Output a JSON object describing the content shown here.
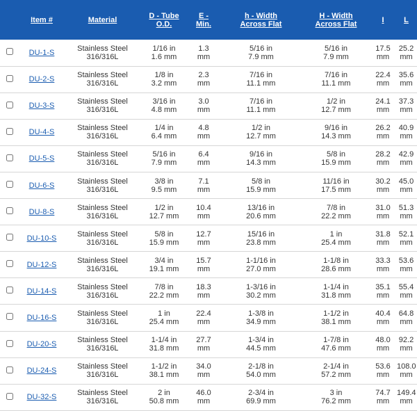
{
  "header": {
    "item": "Item #",
    "material": "Material",
    "d_tube_1": "D - Tube",
    "d_tube_2": "O.D.",
    "e_min_1": "E -",
    "e_min_2": "Min.",
    "h_small_1": "h - Width",
    "h_small_2": "Across Flat",
    "h_big_1": "H - Width",
    "h_big_2": "Across Flat",
    "i": "I",
    "l": "L"
  },
  "rows": [
    {
      "item": "DU-1-S",
      "mat1": "Stainless Steel",
      "mat2": "316/316L",
      "d1": "1/16 in",
      "d2": "1.6 mm",
      "e1": "1.3",
      "e2": "mm",
      "hs1": "5/16 in",
      "hs2": "7.9 mm",
      "hb1": "5/16 in",
      "hb2": "7.9 mm",
      "i1": "17.5",
      "i2": "mm",
      "l1": "25.2",
      "l2": "mm"
    },
    {
      "item": "DU-2-S",
      "mat1": "Stainless Steel",
      "mat2": "316/316L",
      "d1": "1/8 in",
      "d2": "3.2 mm",
      "e1": "2.3",
      "e2": "mm",
      "hs1": "7/16 in",
      "hs2": "11.1 mm",
      "hb1": "7/16 in",
      "hb2": "11.1 mm",
      "i1": "22.4",
      "i2": "mm",
      "l1": "35.6",
      "l2": "mm"
    },
    {
      "item": "DU-3-S",
      "mat1": "Stainless Steel",
      "mat2": "316/316L",
      "d1": "3/16 in",
      "d2": "4.8 mm",
      "e1": "3.0",
      "e2": "mm",
      "hs1": "7/16 in",
      "hs2": "11.1 mm",
      "hb1": "1/2 in",
      "hb2": "12.7 mm",
      "i1": "24.1",
      "i2": "mm",
      "l1": "37.3",
      "l2": "mm"
    },
    {
      "item": "DU-4-S",
      "mat1": "Stainless Steel",
      "mat2": "316/316L",
      "d1": "1/4 in",
      "d2": "6.4 mm",
      "e1": "4.8",
      "e2": "mm",
      "hs1": "1/2 in",
      "hs2": "12.7 mm",
      "hb1": "9/16 in",
      "hb2": "14.3 mm",
      "i1": "26.2",
      "i2": "mm",
      "l1": "40.9",
      "l2": "mm"
    },
    {
      "item": "DU-5-S",
      "mat1": "Stainless Steel",
      "mat2": "316/316L",
      "d1": "5/16 in",
      "d2": "7.9 mm",
      "e1": "6.4",
      "e2": "mm",
      "hs1": "9/16 in",
      "hs2": "14.3 mm",
      "hb1": "5/8 in",
      "hb2": "15.9 mm",
      "i1": "28.2",
      "i2": "mm",
      "l1": "42.9",
      "l2": "mm"
    },
    {
      "item": "DU-6-S",
      "mat1": "Stainless Steel",
      "mat2": "316/316L",
      "d1": "3/8 in",
      "d2": "9.5 mm",
      "e1": "7.1",
      "e2": "mm",
      "hs1": "5/8 in",
      "hs2": "15.9 mm",
      "hb1": "11/16 in",
      "hb2": "17.5 mm",
      "i1": "30.2",
      "i2": "mm",
      "l1": "45.0",
      "l2": "mm"
    },
    {
      "item": "DU-8-S",
      "mat1": "Stainless Steel",
      "mat2": "316/316L",
      "d1": "1/2 in",
      "d2": "12.7 mm",
      "e1": "10.4",
      "e2": "mm",
      "hs1": "13/16 in",
      "hs2": "20.6 mm",
      "hb1": "7/8 in",
      "hb2": "22.2 mm",
      "i1": "31.0",
      "i2": "mm",
      "l1": "51.3",
      "l2": "mm"
    },
    {
      "item": "DU-10-S",
      "mat1": "Stainless Steel",
      "mat2": "316/316L",
      "d1": "5/8 in",
      "d2": "15.9 mm",
      "e1": "12.7",
      "e2": "mm",
      "hs1": "15/16 in",
      "hs2": "23.8 mm",
      "hb1": "1 in",
      "hb2": "25.4 mm",
      "i1": "31.8",
      "i2": "mm",
      "l1": "52.1",
      "l2": "mm"
    },
    {
      "item": "DU-12-S",
      "mat1": "Stainless Steel",
      "mat2": "316/316L",
      "d1": "3/4 in",
      "d2": "19.1 mm",
      "e1": "15.7",
      "e2": "mm",
      "hs1": "1-1/16 in",
      "hs2": "27.0 mm",
      "hb1": "1-1/8 in",
      "hb2": "28.6 mm",
      "i1": "33.3",
      "i2": "mm",
      "l1": "53.6",
      "l2": "mm"
    },
    {
      "item": "DU-14-S",
      "mat1": "Stainless Steel",
      "mat2": "316/316L",
      "d1": "7/8 in",
      "d2": "22.2 mm",
      "e1": "18.3",
      "e2": "mm",
      "hs1": "1-3/16 in",
      "hs2": "30.2 mm",
      "hb1": "1-1/4 in",
      "hb2": "31.8 mm",
      "i1": "35.1",
      "i2": "mm",
      "l1": "55.4",
      "l2": "mm"
    },
    {
      "item": "DU-16-S",
      "mat1": "Stainless Steel",
      "mat2": "316/316L",
      "d1": "1 in",
      "d2": "25.4 mm",
      "e1": "22.4",
      "e2": "mm",
      "hs1": "1-3/8 in",
      "hs2": "34.9 mm",
      "hb1": "1-1/2 in",
      "hb2": "38.1 mm",
      "i1": "40.4",
      "i2": "mm",
      "l1": "64.8",
      "l2": "mm"
    },
    {
      "item": "DU-20-S",
      "mat1": "Stainless Steel",
      "mat2": "316/316L",
      "d1": "1-1/4 in",
      "d2": "31.8 mm",
      "e1": "27.7",
      "e2": "mm",
      "hs1": "1-3/4 in",
      "hs2": "44.5 mm",
      "hb1": "1-7/8 in",
      "hb2": "47.6 mm",
      "i1": "48.0",
      "i2": "mm",
      "l1": "92.2",
      "l2": "mm"
    },
    {
      "item": "DU-24-S",
      "mat1": "Stainless Steel",
      "mat2": "316/316L",
      "d1": "1-1/2 in",
      "d2": "38.1 mm",
      "e1": "34.0",
      "e2": "mm",
      "hs1": "2-1/8 in",
      "hs2": "54.0 mm",
      "hb1": "2-1/4 in",
      "hb2": "57.2 mm",
      "i1": "53.6",
      "i2": "mm",
      "l1": "108.0",
      "l2": "mm"
    },
    {
      "item": "DU-32-S",
      "mat1": "Stainless Steel",
      "mat2": "316/316L",
      "d1": "2 in",
      "d2": "50.8 mm",
      "e1": "46.0",
      "e2": "mm",
      "hs1": "2-3/4 in",
      "hs2": "69.9 mm",
      "hb1": "3 in",
      "hb2": "76.2 mm",
      "i1": "74.7",
      "i2": "mm",
      "l1": "149.4",
      "l2": "mm"
    }
  ],
  "colors": {
    "header_bg": "#1a5cb0",
    "link": "#1a5cb0"
  }
}
